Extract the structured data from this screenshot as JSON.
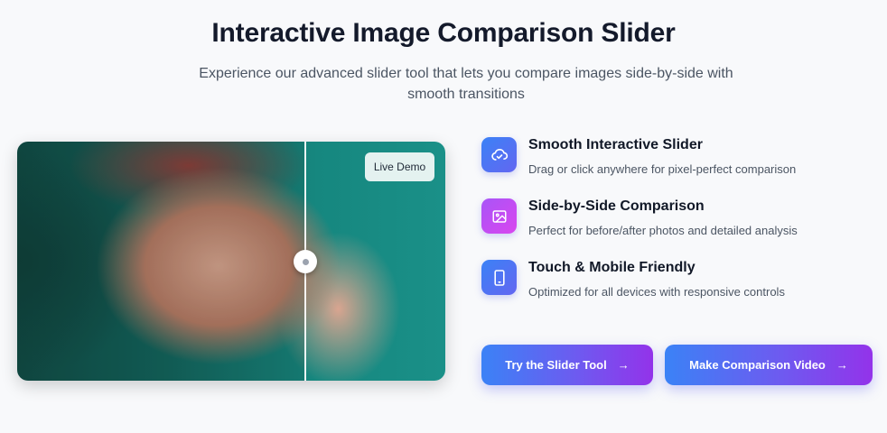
{
  "header": {
    "title": "Interactive Image Comparison Slider",
    "subtitle": "Experience our advanced slider tool that lets you compare images side-by-side with smooth transitions"
  },
  "demo": {
    "badge": "Live Demo",
    "slider_position_percent": 67
  },
  "features": [
    {
      "icon": "cloud-sync-icon",
      "title": "Smooth Interactive Slider",
      "description": "Drag or click anywhere for pixel-perfect comparison",
      "color_start": "#3b82f6",
      "color_end": "#6366f1"
    },
    {
      "icon": "image-icon",
      "title": "Side-by-Side Comparison",
      "description": "Perfect for before/after photos and detailed analysis",
      "color_start": "#a855f7",
      "color_end": "#d946ef"
    },
    {
      "icon": "smartphone-icon",
      "title": "Touch & Mobile Friendly",
      "description": "Optimized for all devices with responsive controls",
      "color_start": "#3b82f6",
      "color_end": "#6366f1"
    }
  ],
  "buttons": {
    "primary": {
      "label": "Try the Slider Tool",
      "icon": "arrow-right-icon",
      "arrow": "→"
    },
    "secondary": {
      "label": "Make Comparison Video",
      "icon": "arrow-right-icon",
      "arrow": "→"
    }
  },
  "colors": {
    "accent_blue": "#3b82f6",
    "accent_purple": "#9333ea",
    "page_bg": "#f8f9fb",
    "teal_bg": "#16877f"
  }
}
